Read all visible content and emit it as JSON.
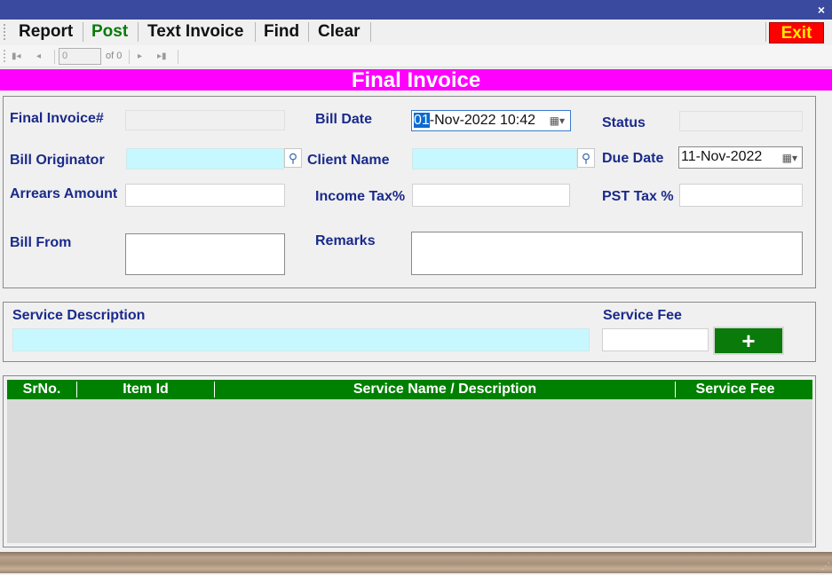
{
  "window": {
    "close_glyph": "×"
  },
  "menu": {
    "report": "Report",
    "post": "Post",
    "text_invoice": "Text Invoice",
    "find": "Find",
    "clear": "Clear",
    "exit": "Exit"
  },
  "nav": {
    "first_glyph": "▮◂",
    "prev_glyph": "◂",
    "page_value": "0",
    "of_label": "of 0",
    "next_glyph": "▸",
    "last_glyph": "▸▮"
  },
  "banner": {
    "title": "Final Invoice"
  },
  "form": {
    "final_invoice_label": "Final Invoice#",
    "final_invoice_value": "",
    "bill_date_label": "Bill Date",
    "bill_date_selected": "01",
    "bill_date_rest": "-Nov-2022 10:42",
    "status_label": "Status",
    "status_value": "",
    "bill_originator_label": "Bill Originator",
    "bill_originator_value": "",
    "client_name_label": "Client Name",
    "client_name_value": "",
    "due_date_label": "Due Date",
    "due_date_value": "11-Nov-2022",
    "arrears_amount_label": "Arrears Amount",
    "arrears_amount_value": "",
    "income_tax_label": "Income Tax%",
    "income_tax_value": "",
    "pst_tax_label": "PST Tax %",
    "pst_tax_value": "",
    "bill_from_label": "Bill From",
    "bill_from_value": "",
    "remarks_label": "Remarks",
    "remarks_value": ""
  },
  "service": {
    "description_label": "Service Description",
    "description_value": "",
    "fee_label": "Service Fee",
    "fee_value": "",
    "add_glyph": "+"
  },
  "grid": {
    "columns": [
      "SrNo.",
      "Item Id",
      "Service Name / Description",
      "Service Fee"
    ],
    "rows": []
  },
  "colors": {
    "titlebar": "#3a4a9e",
    "banner": "#ff00ff",
    "label": "#1a2a8a",
    "grid_header": "#008000",
    "add_button": "#0a7a0a",
    "exit_bg": "#ff0000",
    "exit_text": "#ffea00",
    "cyan_field": "#c8f8ff"
  }
}
